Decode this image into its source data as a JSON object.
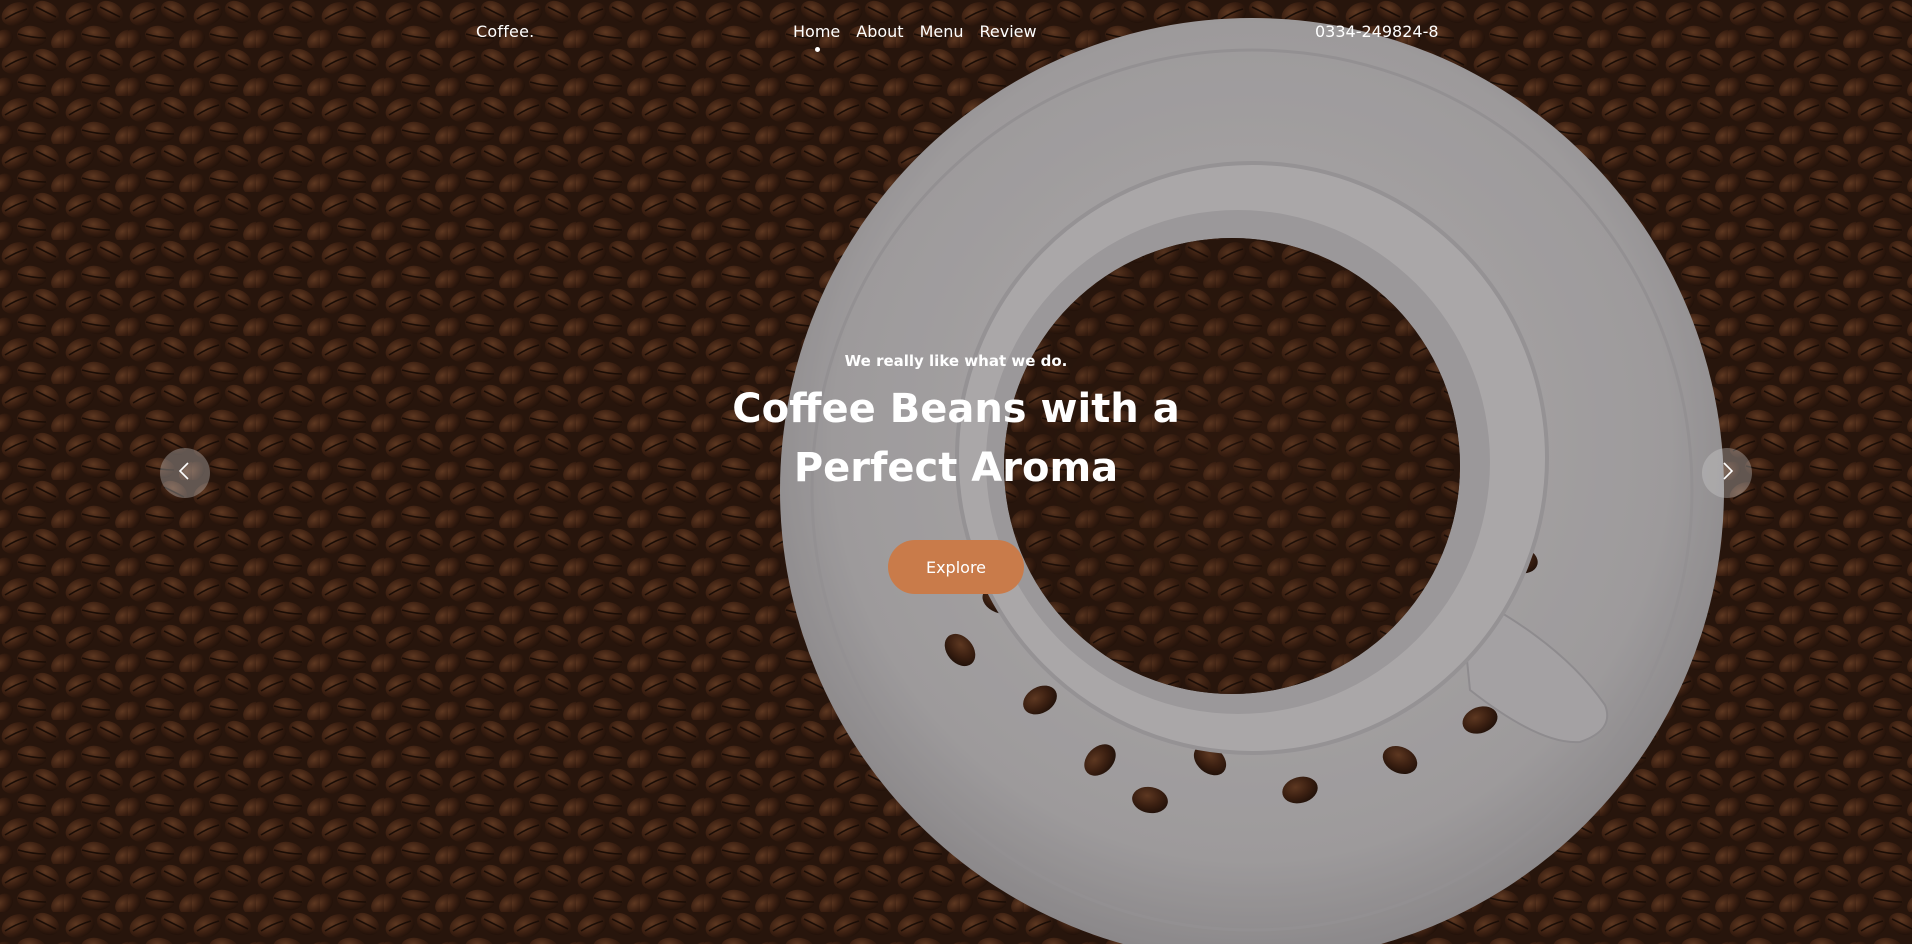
{
  "brand": "Coffee.",
  "nav": {
    "items": [
      {
        "label": "Home",
        "active": true
      },
      {
        "label": "About",
        "active": false
      },
      {
        "label": "Menu",
        "active": false
      },
      {
        "label": "Review",
        "active": false
      }
    ]
  },
  "phone": "0334-249824-8",
  "hero": {
    "tagline": "We really like what we do.",
    "headline": "Coffee Beans with a Perfect Aroma",
    "cta_label": "Explore"
  },
  "carousel": {
    "prev_icon": "chevron-left-icon",
    "next_icon": "chevron-right-icon"
  },
  "colors": {
    "accent": "#c97b4a",
    "text": "#ffffff",
    "background": "#3b2214"
  }
}
